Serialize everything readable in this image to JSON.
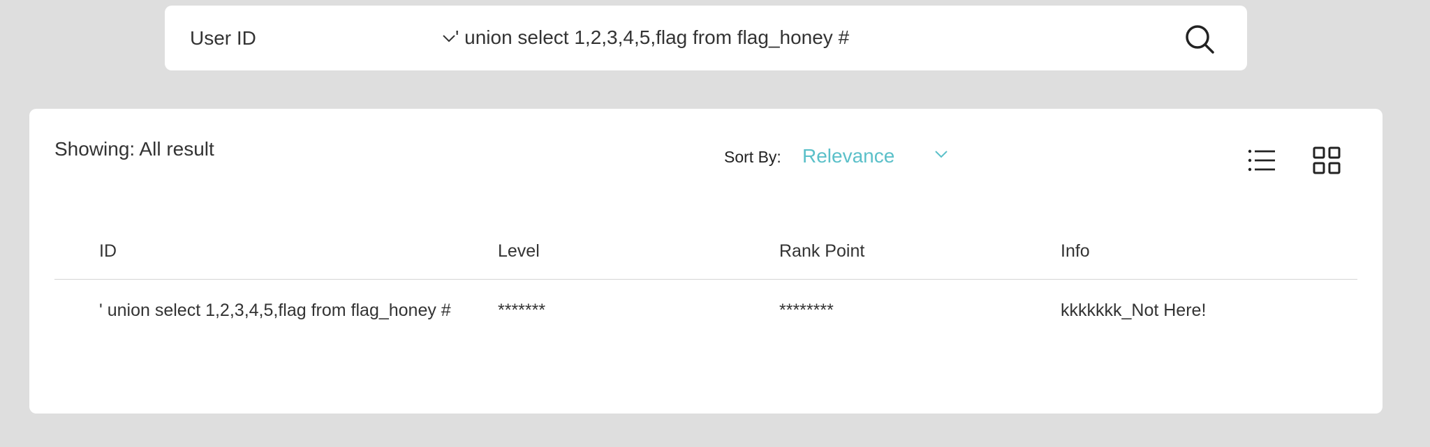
{
  "search": {
    "type_label": "User ID",
    "query": "' union select 1,2,3,4,5,flag from flag_honey #"
  },
  "results": {
    "showing_label": "Showing: All result",
    "sort": {
      "label": "Sort By:",
      "value": "Relevance"
    },
    "columns": [
      "ID",
      "Level",
      "Rank Point",
      "Info"
    ],
    "rows": [
      [
        "' union select 1,2,3,4,5,flag from flag_honey #",
        "*******",
        "********",
        "kkkkkkk_Not Here!"
      ]
    ]
  },
  "icons": {
    "search": "search-icon",
    "type_dropdown": "chevron-down-icon",
    "sort_dropdown": "chevron-down-icon",
    "list_view": "list-view-icon",
    "grid_view": "grid-view-icon"
  },
  "colors": {
    "accent": "#5bc0c9",
    "background": "#dedede",
    "card": "#ffffff",
    "text": "#333333"
  }
}
